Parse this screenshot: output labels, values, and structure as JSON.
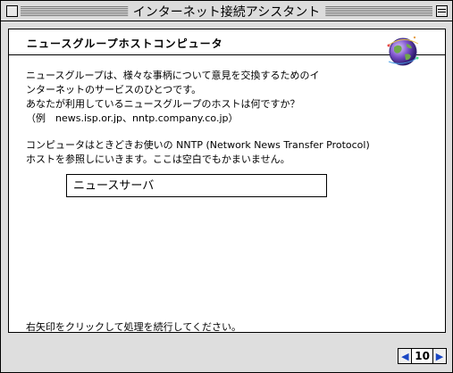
{
  "window": {
    "title": "インターネット接続アシスタント"
  },
  "header": {
    "title": "ニュースグループホストコンピュータ",
    "icon": "globe-icon"
  },
  "body": {
    "line1": "ニュースグループは、様々な事柄について意見を交換するためのイ",
    "line2": "ンターネットのサービスのひとつです。",
    "line3": "あなたが利用しているニュースグループのホストは何ですか？",
    "line4": "（例　news.isp.or.jp、nntp.company.co.jp）",
    "line5": "コンピュータはときどきお使いの NNTP (Network News Transfer Protocol)",
    "line6": "ホストを参照しにいきます。ここは空白でもかまいません。"
  },
  "server_field": {
    "value": "ニュースサーバ"
  },
  "footer": {
    "instruction": "右矢印をクリックして処理を続行してください。"
  },
  "nav": {
    "prev_icon": "left-arrow-icon",
    "next_icon": "right-arrow-icon",
    "page": "10",
    "prev_glyph": "◀",
    "next_glyph": "▶"
  }
}
